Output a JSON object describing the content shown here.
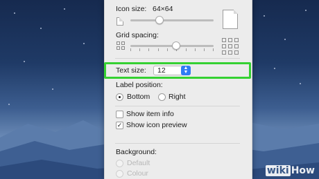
{
  "icon_size": {
    "label": "Icon size:",
    "value": "64×64",
    "level": 0.35
  },
  "grid_spacing": {
    "label": "Grid spacing:",
    "level": 0.55
  },
  "text_size": {
    "label": "Text size:",
    "value": "12"
  },
  "label_position": {
    "label": "Label position:",
    "options": [
      "Bottom",
      "Right"
    ],
    "selected": "Bottom"
  },
  "show_item_info": {
    "label": "Show item info",
    "checked": false
  },
  "show_icon_preview": {
    "label": "Show icon preview",
    "checked": true
  },
  "background": {
    "label": "Background:",
    "options": [
      "Default",
      "Colour"
    ],
    "disabled": true
  },
  "watermark": {
    "prefix": "wiki",
    "suffix": "How"
  },
  "colors": {
    "highlight": "#35d132",
    "accent": "#2f7cf6"
  }
}
